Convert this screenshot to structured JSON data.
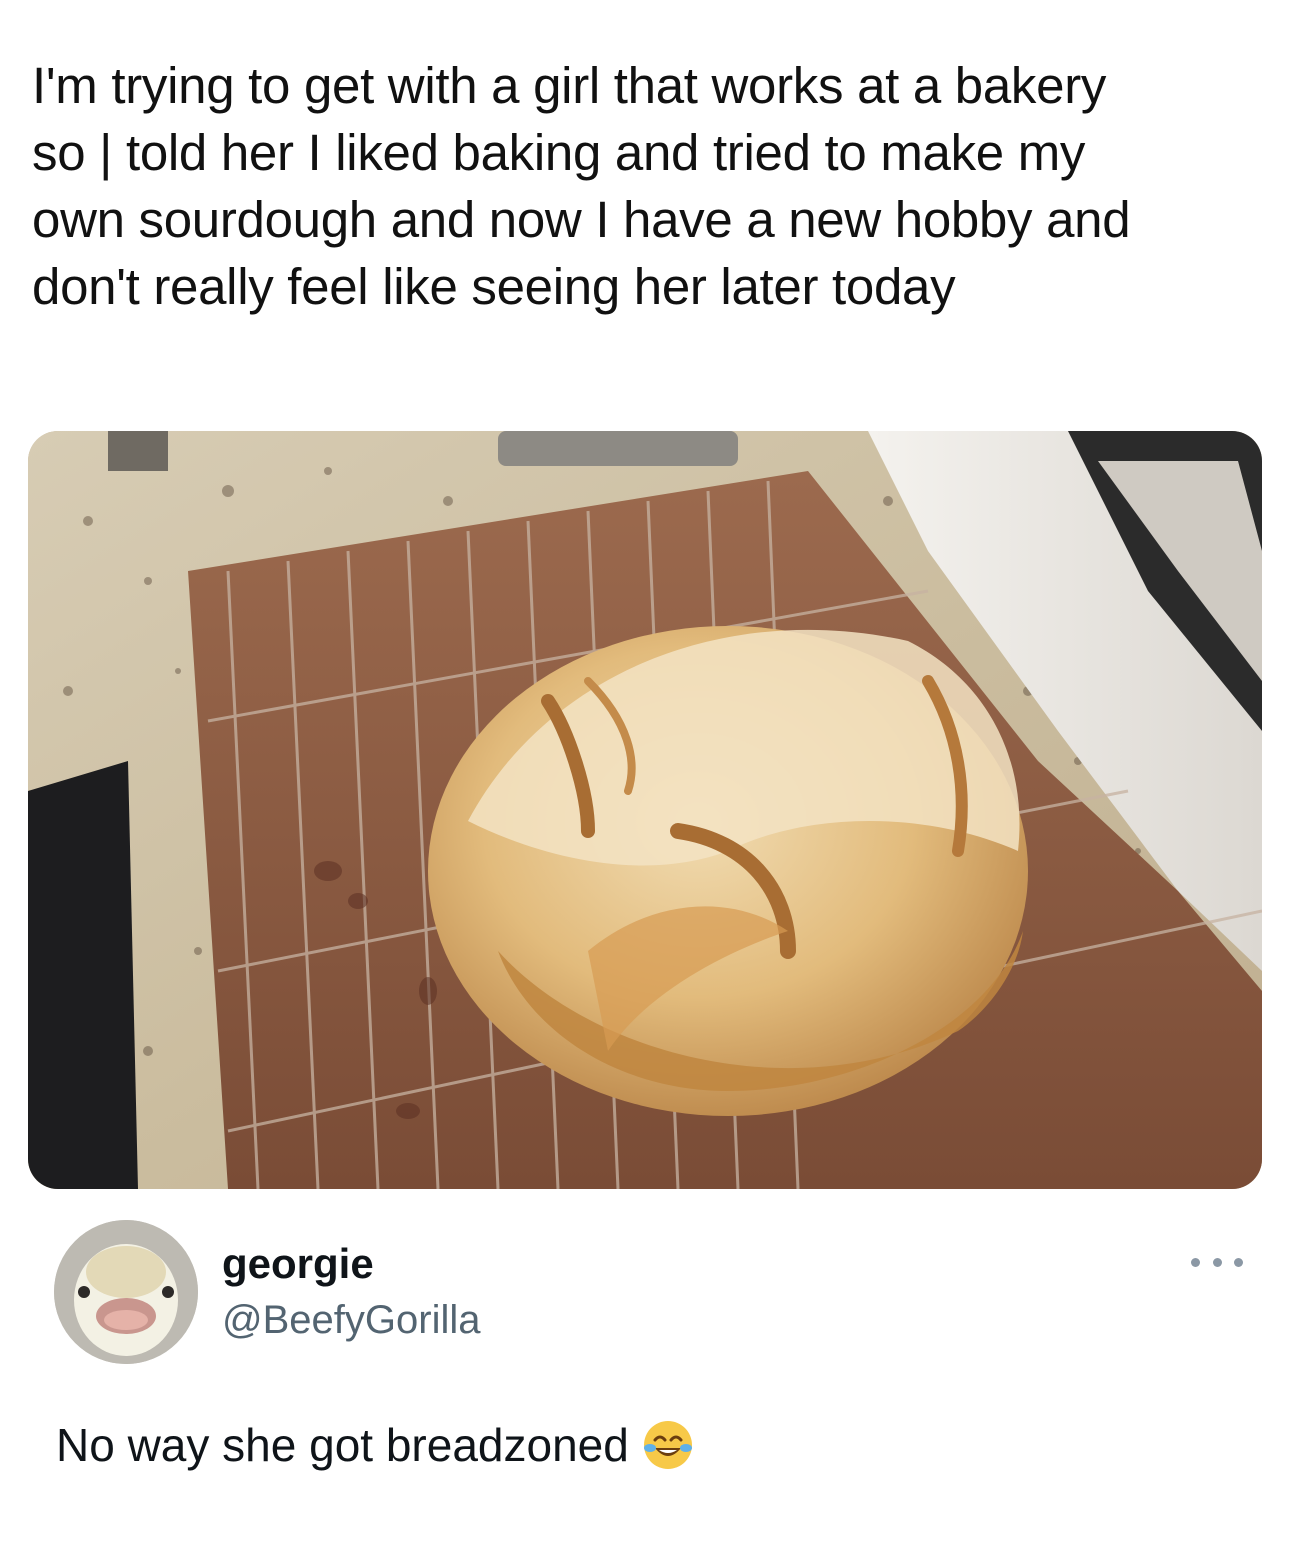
{
  "caption": {
    "lines": [
      "I'm trying to get with a girl that works at a bakery",
      "so | told her I liked baking and tried to make my",
      "own sourdough and now I have a new hobby and",
      "don't really feel like seeing her later today"
    ]
  },
  "post": {
    "display_name": "georgie",
    "handle": "@BeefyGorilla",
    "reply_text": "No way she got breadzoned",
    "reply_emoji": "face-with-tears-of-joy-icon",
    "more_icon": "more-options-icon"
  },
  "colors": {
    "handle": "#536471",
    "text": "#0f1419"
  }
}
